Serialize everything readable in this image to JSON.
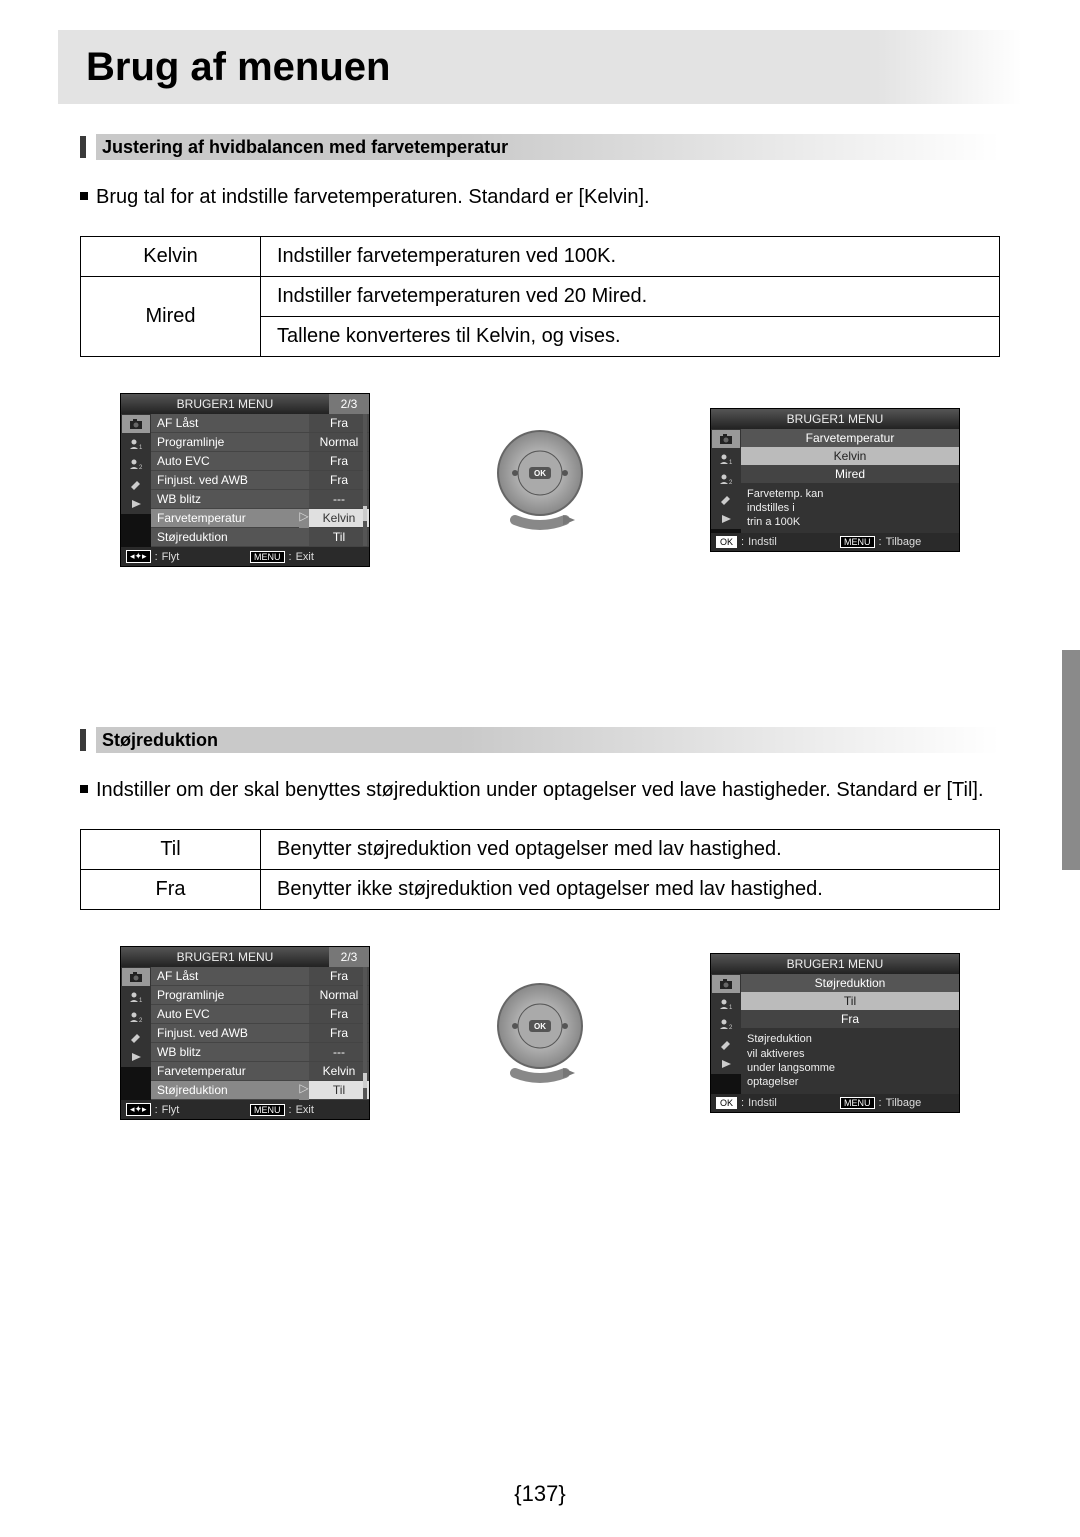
{
  "page_title": "Brug af menuen",
  "page_number": "{137}",
  "section1": {
    "heading": "Justering af hvidbalancen med farvetemperatur",
    "intro": "Brug tal for at indstille farvetemperaturen. Standard er [Kelvin].",
    "table": {
      "r1c1": "Kelvin",
      "r1c2": "Indstiller farvetemperaturen ved 100K.",
      "r2c1": "Mired",
      "r2c2a": "Indstiller farvetemperaturen ved 20 Mired.",
      "r2c2b": "Tallene konverteres til Kelvin, og vises."
    },
    "menu_left": {
      "title": "BRUGER1 MENU",
      "page": "2/3",
      "items": [
        {
          "label": "AF Låst",
          "val": "Fra"
        },
        {
          "label": "Programlinje",
          "val": "Normal"
        },
        {
          "label": "Auto EVC",
          "val": "Fra"
        },
        {
          "label": "Finjust. ved AWB",
          "val": "Fra"
        },
        {
          "label": "WB blitz",
          "val": "---"
        },
        {
          "label": "Farvetemperatur",
          "val": "Kelvin",
          "selected": true
        },
        {
          "label": "Støjreduktion",
          "val": "Til"
        }
      ],
      "footer_move": "Flyt",
      "footer_menu": "MENU",
      "footer_exit": "Exit"
    },
    "menu_right": {
      "title": "BRUGER1 MENU",
      "sub_head": "Farvetemperatur",
      "opts": [
        "Kelvin",
        "Mired"
      ],
      "selected": 0,
      "desc": "Farvetemp. kan\nindstilles i\ntrin a 100K",
      "footer_ok": "OK",
      "footer_set": "Indstil",
      "footer_menu": "MENU",
      "footer_back": "Tilbage"
    }
  },
  "section2": {
    "heading": "Støjreduktion",
    "intro": "Indstiller om der skal benyttes støjreduktion under optagelser ved lave hastigheder. Standard er [Til].",
    "table": {
      "r1c1": "Til",
      "r1c2": "Benytter støjreduktion ved optagelser med lav hastighed.",
      "r2c1": "Fra",
      "r2c2": "Benytter ikke støjreduktion ved optagelser med lav hastighed."
    },
    "menu_left": {
      "title": "BRUGER1 MENU",
      "page": "2/3",
      "items": [
        {
          "label": "AF Låst",
          "val": "Fra"
        },
        {
          "label": "Programlinje",
          "val": "Normal"
        },
        {
          "label": "Auto EVC",
          "val": "Fra"
        },
        {
          "label": "Finjust. ved AWB",
          "val": "Fra"
        },
        {
          "label": "WB blitz",
          "val": "---"
        },
        {
          "label": "Farvetemperatur",
          "val": "Kelvin"
        },
        {
          "label": "Støjreduktion",
          "val": "Til",
          "selected": true
        }
      ],
      "footer_move": "Flyt",
      "footer_menu": "MENU",
      "footer_exit": "Exit"
    },
    "menu_right": {
      "title": "BRUGER1 MENU",
      "sub_head": "Støjreduktion",
      "opts": [
        "Til",
        "Fra"
      ],
      "selected": 0,
      "desc": "Støjreduktion\nvil aktiveres\nunder langsomme\noptagelser",
      "footer_ok": "OK",
      "footer_set": "Indstil",
      "footer_menu": "MENU",
      "footer_back": "Tilbage"
    }
  },
  "icons": {
    "nav_dpad": "◀✦▶",
    "camera": "camera-icon",
    "person1": "person-1-icon",
    "person2": "person-2-icon",
    "tool": "tool-icon",
    "play": "play-icon"
  }
}
